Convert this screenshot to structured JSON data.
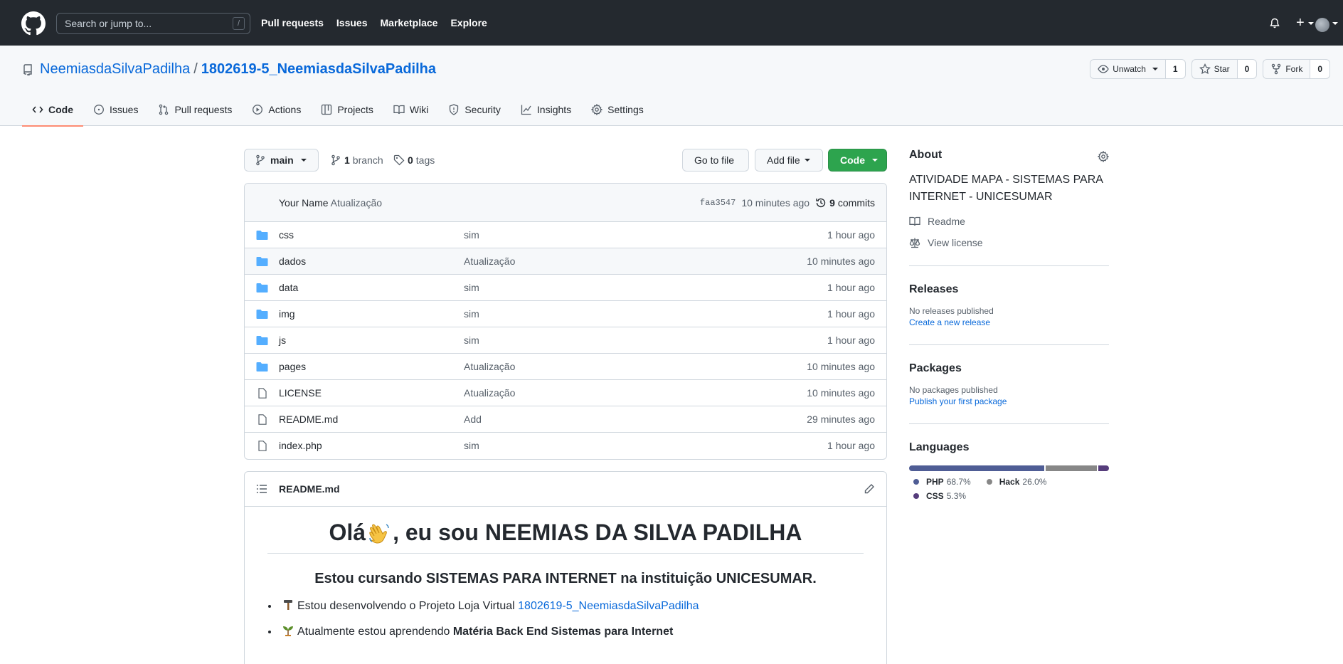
{
  "header": {
    "search_placeholder": "Search or jump to...",
    "search_shortcut": "/",
    "nav": [
      "Pull requests",
      "Issues",
      "Marketplace",
      "Explore"
    ],
    "plus_label": "+"
  },
  "repo": {
    "owner": "NeemiasdaSilvaPadilha",
    "separator": "/",
    "name": "1802619-5_NeemiasdaSilvaPadilha",
    "watch": {
      "label": "Unwatch",
      "count": "1"
    },
    "star": {
      "label": "Star",
      "count": "0"
    },
    "fork": {
      "label": "Fork",
      "count": "0"
    },
    "tabs": [
      {
        "label": "Code",
        "icon": "code-icon"
      },
      {
        "label": "Issues",
        "icon": "issue-opened-icon"
      },
      {
        "label": "Pull requests",
        "icon": "git-pull-request-icon"
      },
      {
        "label": "Actions",
        "icon": "play-icon"
      },
      {
        "label": "Projects",
        "icon": "table-icon"
      },
      {
        "label": "Wiki",
        "icon": "book-icon"
      },
      {
        "label": "Security",
        "icon": "shield-icon"
      },
      {
        "label": "Insights",
        "icon": "graph-icon"
      },
      {
        "label": "Settings",
        "icon": "gear-icon"
      }
    ]
  },
  "toolbar": {
    "branch": "main",
    "branches_count": "1",
    "branches_label": "branch",
    "tags_count": "0",
    "tags_label": "tags",
    "go_to_file": "Go to file",
    "add_file": "Add file",
    "code": "Code"
  },
  "commit": {
    "author": "Your Name",
    "message": "Atualização",
    "sha": "faa3547",
    "time": "10 minutes ago",
    "commits_count": "9",
    "commits_label": "commits"
  },
  "files": [
    {
      "type": "folder",
      "name": "css",
      "message": "sim",
      "age": "1 hour ago"
    },
    {
      "type": "folder",
      "name": "dados",
      "message": "Atualização",
      "age": "10 minutes ago"
    },
    {
      "type": "folder",
      "name": "data",
      "message": "sim",
      "age": "1 hour ago"
    },
    {
      "type": "folder",
      "name": "img",
      "message": "sim",
      "age": "1 hour ago"
    },
    {
      "type": "folder",
      "name": "js",
      "message": "sim",
      "age": "1 hour ago"
    },
    {
      "type": "folder",
      "name": "pages",
      "message": "Atualização",
      "age": "10 minutes ago"
    },
    {
      "type": "file",
      "name": "LICENSE",
      "message": "Atualização",
      "age": "10 minutes ago"
    },
    {
      "type": "file",
      "name": "README.md",
      "message": "Add",
      "age": "29 minutes ago"
    },
    {
      "type": "file",
      "name": "index.php",
      "message": "sim",
      "age": "1 hour ago"
    }
  ],
  "readme": {
    "title": "README.md",
    "h1_before": "Olá",
    "h1_after": ", eu sou NEEMIAS DA SILVA PADILHA",
    "h3": "Estou cursando SISTEMAS PARA INTERNET na instituição UNICESUMAR.",
    "item1_text": "Estou desenvolvendo o Projeto Loja Virtual",
    "item1_link": "1802619-5_NeemiasdaSilvaPadilha",
    "item2_text": "Atualmente estou aprendendo",
    "item2_bold": "Matéria Back End Sistemas para Internet"
  },
  "about": {
    "heading": "About",
    "description": "ATIVIDADE MAPA - SISTEMAS PARA INTERNET - UNICESUMAR",
    "readme_link": "Readme",
    "license_link": "View license"
  },
  "releases": {
    "heading": "Releases",
    "empty": "No releases published",
    "create": "Create a new release"
  },
  "packages": {
    "heading": "Packages",
    "empty": "No packages published",
    "publish": "Publish your first package"
  },
  "languages": {
    "heading": "Languages",
    "items": [
      {
        "name": "PHP",
        "percent": "68.7%",
        "value": 68.7,
        "color": "#4F5D95"
      },
      {
        "name": "Hack",
        "percent": "26.0%",
        "value": 26.0,
        "color": "#878787"
      },
      {
        "name": "CSS",
        "percent": "5.3%",
        "value": 5.3,
        "color": "#563d7c"
      }
    ]
  }
}
